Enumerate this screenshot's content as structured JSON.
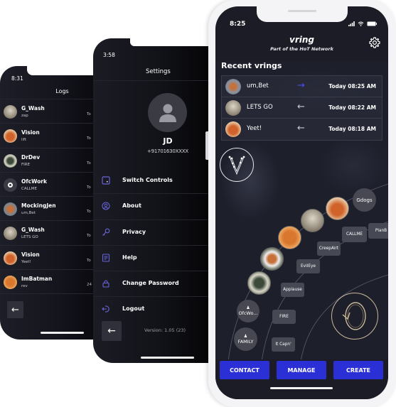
{
  "logs_screen": {
    "status_time": "8:31",
    "title": "Logs",
    "items": [
      {
        "name": "G_Wash",
        "message": "zap",
        "timestamp": "To",
        "avatar": "washington-avatar"
      },
      {
        "name": "Vision",
        "message": "lift",
        "timestamp": "To",
        "avatar": "fox-avatar"
      },
      {
        "name": "DrDev",
        "message": "FIRE",
        "timestamp": "To",
        "avatar": "pattern-avatar"
      },
      {
        "name": "OfcWork",
        "message": "CALLME",
        "timestamp": "To",
        "avatar": "group-avatar"
      },
      {
        "name": "MockingJen",
        "message": "um,Bet",
        "timestamp": "To",
        "avatar": "deer-avatar"
      },
      {
        "name": "G_Wash",
        "message": "LETS GO",
        "timestamp": "To",
        "avatar": "washington-avatar"
      },
      {
        "name": "Vision",
        "message": "Yeet!",
        "timestamp": "To",
        "avatar": "fox-avatar"
      },
      {
        "name": "ImBatman",
        "message": "rev",
        "timestamp": "24",
        "avatar": "orange-avatar"
      }
    ],
    "back_icon": "←"
  },
  "settings_screen": {
    "status_time": "3:58",
    "title": "Settings",
    "profile": {
      "initials": "JD",
      "phone": "+91701630XXXX"
    },
    "menu": [
      {
        "label": "Switch Controls",
        "icon": "switch-icon"
      },
      {
        "label": "About",
        "icon": "user-circle-icon"
      },
      {
        "label": "Privacy",
        "icon": "key-icon"
      },
      {
        "label": "Help",
        "icon": "document-icon"
      },
      {
        "label": "Change Password",
        "icon": "lock-icon"
      },
      {
        "label": "Logout",
        "icon": "logout-icon"
      }
    ],
    "back_icon": "←",
    "version": "Version: 1.05 (23)"
  },
  "main_screen": {
    "status_time": "8:25",
    "app_title": "vring",
    "app_subtitle": "Part of the HoT Network",
    "recent_title": "Recent vrings",
    "recent": [
      {
        "message": "um,Bet",
        "direction": "outgoing",
        "arrow": "→",
        "timestamp": "Today 08:25 AM"
      },
      {
        "message": "LETS GO",
        "direction": "incoming",
        "arrow": "←",
        "timestamp": "Today 08:22 AM"
      },
      {
        "message": "Yeet!",
        "direction": "incoming",
        "arrow": "←",
        "timestamp": "Today 08:18 AM"
      }
    ],
    "contacts_ring": {
      "bubbles": [
        "Gdogs",
        "OfcWo...",
        "FAMILY"
      ],
      "pills": [
        "CALLME",
        "PlanB",
        "CreepAirt",
        "EvilEye",
        "Applause",
        "FIRE",
        "It Capn'"
      ]
    },
    "actions": [
      "CONTACT",
      "MANAGE",
      "CREATE"
    ],
    "colors": {
      "accent": "#2b2fd6",
      "outgoing_arrow": "#4b4ff0",
      "background": "#1b1c25"
    }
  }
}
